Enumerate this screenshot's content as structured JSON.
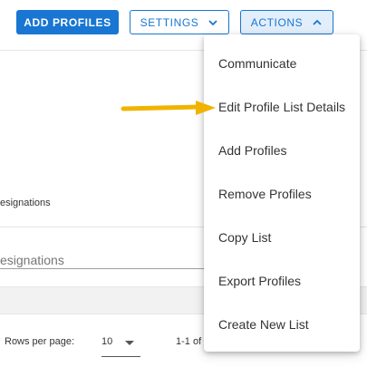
{
  "toolbar": {
    "add_profiles_label": "ADD PROFILES",
    "settings_label": "SETTINGS",
    "actions_label": "ACTIONS",
    "settings_icon": "chevron-down-icon",
    "actions_icon": "chevron-up-icon"
  },
  "filters": {
    "designations_label": "esignations",
    "designations_placeholder": "esignations"
  },
  "pagination": {
    "rows_per_page_label": "Rows per page:",
    "rows_per_page_value": "10",
    "range_text": "1-1 of"
  },
  "actions_menu": {
    "items": [
      {
        "label": "Communicate"
      },
      {
        "label": "Edit Profile List Details"
      },
      {
        "label": "Add Profiles"
      },
      {
        "label": "Remove Profiles"
      },
      {
        "label": "Copy List"
      },
      {
        "label": "Export Profiles"
      },
      {
        "label": "Create New List"
      }
    ]
  },
  "annotation": {
    "arrow_color": "#f0b400",
    "icon": "arrow-right-icon"
  },
  "colors": {
    "primary": "#1976d2",
    "actions_active_bg": "#e3eefb"
  }
}
